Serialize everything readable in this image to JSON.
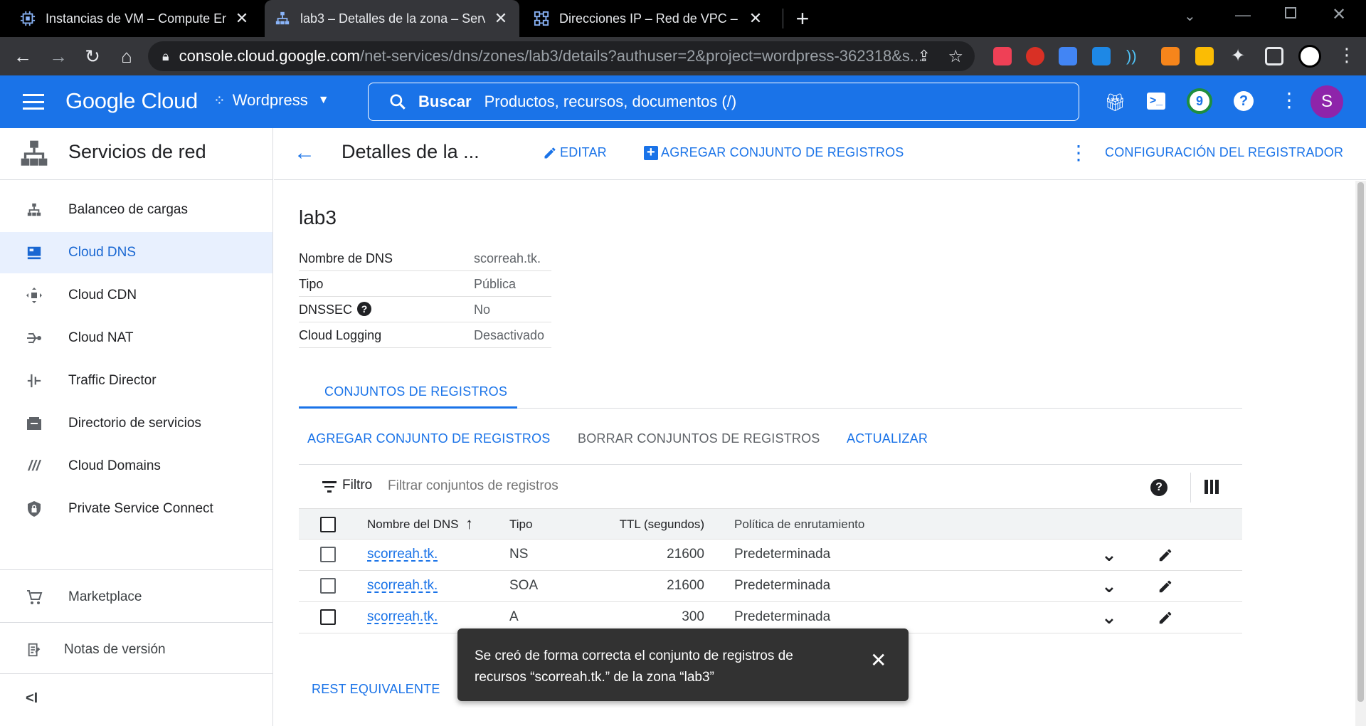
{
  "browser": {
    "tabs": [
      {
        "title": "Instancias de VM – Compute Eng",
        "active": false
      },
      {
        "title": "lab3 – Detalles de la zona – Servi",
        "active": true
      },
      {
        "title": "Direcciones IP – Red de VPC – W",
        "active": false
      }
    ],
    "new_tab": "+",
    "url_host": "console.cloud.google.com",
    "url_path": "/net-services/dns/zones/lab3/details?authuser=2&project=wordpress-362318&s..."
  },
  "header": {
    "brand": "Google Cloud",
    "project": "Wordpress",
    "search_label": "Buscar",
    "search_placeholder": "Productos, recursos, documentos (/)",
    "notifications_count": "9",
    "avatar_letter": "S"
  },
  "sidebar": {
    "title": "Servicios de red",
    "items": [
      {
        "label": "Balanceo de cargas",
        "icon": "load-balancing-icon"
      },
      {
        "label": "Cloud DNS",
        "icon": "cloud-dns-icon",
        "active": true
      },
      {
        "label": "Cloud CDN",
        "icon": "cloud-cdn-icon"
      },
      {
        "label": "Cloud NAT",
        "icon": "cloud-nat-icon"
      },
      {
        "label": "Traffic Director",
        "icon": "traffic-director-icon"
      },
      {
        "label": "Directorio de servicios",
        "icon": "service-directory-icon"
      },
      {
        "label": "Cloud Domains",
        "icon": "cloud-domains-icon"
      },
      {
        "label": "Private Service Connect",
        "icon": "private-service-connect-icon"
      }
    ],
    "marketplace": "Marketplace",
    "release_notes": "Notas de versión",
    "collapse": "<I"
  },
  "page": {
    "title": "Detalles de la ...",
    "edit": "EDITAR",
    "add_record_set": "AGREGAR CONJUNTO DE REGISTROS",
    "registrar_config": "CONFIGURACIÓN DEL REGISTRADOR"
  },
  "zone": {
    "name": "lab3",
    "details": [
      {
        "label": "Nombre de DNS",
        "value": "scorreah.tk."
      },
      {
        "label": "Tipo",
        "value": "Pública"
      },
      {
        "label": "DNSSEC",
        "value": "No"
      },
      {
        "label": "Cloud Logging",
        "value": "Desactivado"
      }
    ]
  },
  "tabs": {
    "record_sets": "CONJUNTOS DE REGISTROS"
  },
  "actions": {
    "add": "AGREGAR CONJUNTO DE REGISTROS",
    "delete": "BORRAR CONJUNTOS DE REGISTROS",
    "refresh": "ACTUALIZAR"
  },
  "filter": {
    "label": "Filtro",
    "placeholder": "Filtrar conjuntos de registros"
  },
  "table": {
    "columns": [
      "Nombre del DNS",
      "Tipo",
      "TTL (segundos)",
      "Política de enrutamiento"
    ],
    "rows": [
      {
        "name": "scorreah.tk.",
        "type": "NS",
        "ttl": "21600",
        "policy": "Predeterminada"
      },
      {
        "name": "scorreah.tk.",
        "type": "SOA",
        "ttl": "21600",
        "policy": "Predeterminada"
      },
      {
        "name": "scorreah.tk.",
        "type": "A",
        "ttl": "300",
        "policy": "Predeterminada"
      }
    ]
  },
  "rest_equivalent": "REST EQUIVALENTE",
  "toast": {
    "line1": "Se creó de forma correcta el conjunto de registros de",
    "line2": "recursos “scorreah.tk.” de la zona “lab3”"
  },
  "colors": {
    "brand_blue": "#1a73e8",
    "tab_bar": "#000000",
    "toolbar": "#35363a",
    "toast": "#323232"
  }
}
